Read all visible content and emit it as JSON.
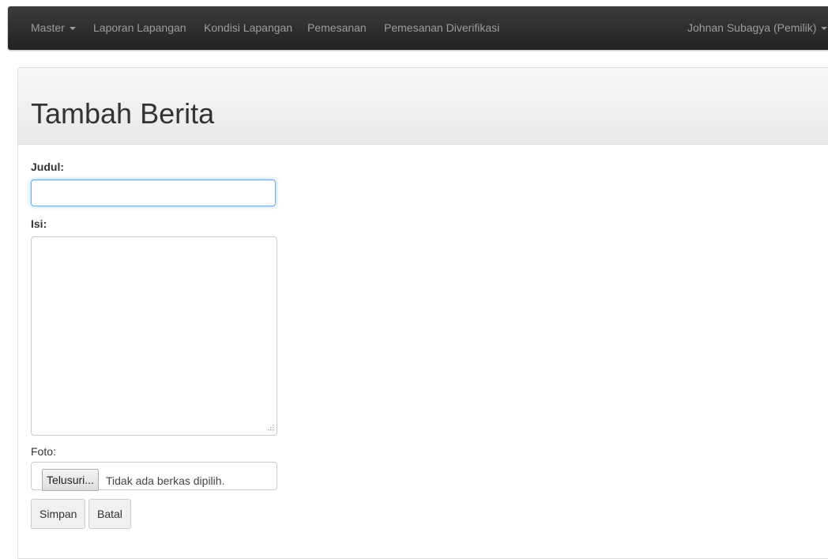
{
  "navbar": {
    "items": [
      {
        "label": "Master",
        "has_dropdown": true
      },
      {
        "label": "Laporan Lapangan"
      },
      {
        "label": "Kondisi Lapangan"
      },
      {
        "label": "Pemesanan"
      },
      {
        "label": "Pemesanan Diverifikasi"
      }
    ],
    "user": {
      "label": "Johnan Subagya (Pemilik)",
      "has_dropdown": true
    }
  },
  "page": {
    "title": "Tambah Berita"
  },
  "form": {
    "judul_label": "Judul:",
    "judul_value": "",
    "isi_label": "Isi:",
    "isi_value": "",
    "foto_label": "Foto:",
    "browse_label": "Telusuri...",
    "file_status": "Tidak ada berkas dipilih.",
    "save_label": "Simpan",
    "cancel_label": "Batal"
  },
  "colors": {
    "navbar_bg": "#222222",
    "nav_text": "#9d9d9d",
    "focus_border": "#66afe9"
  }
}
